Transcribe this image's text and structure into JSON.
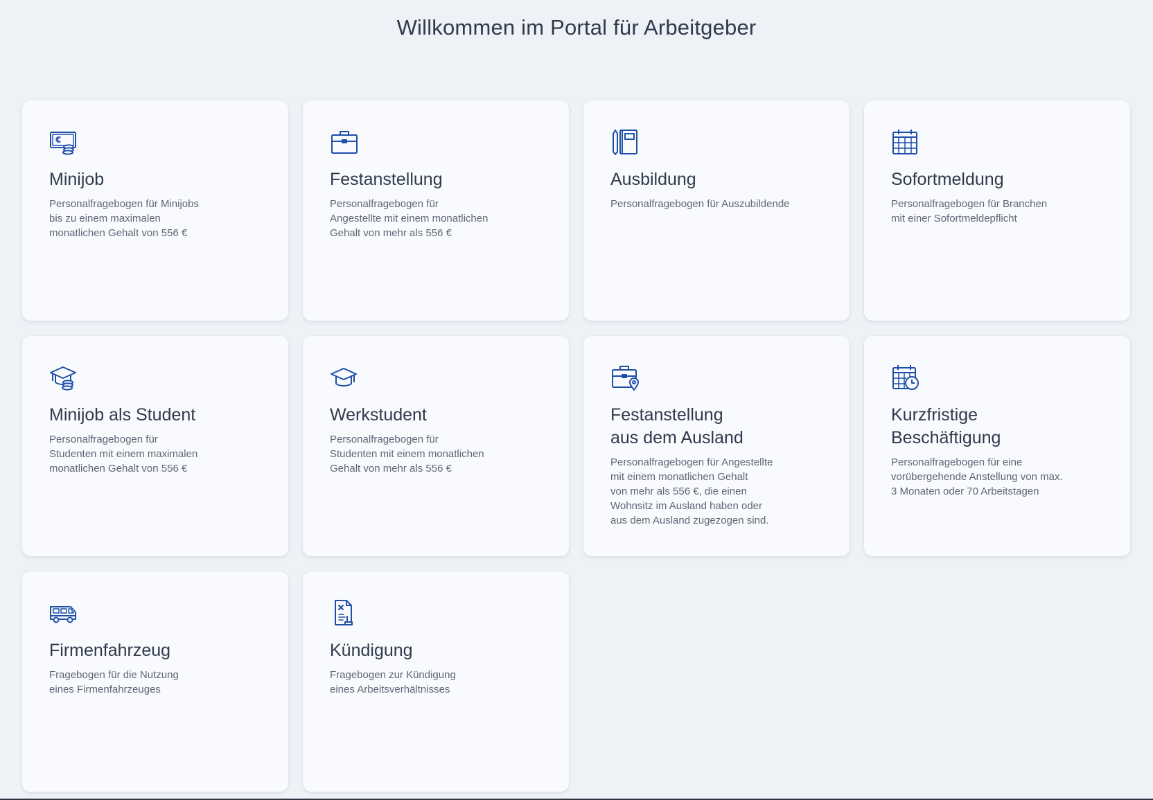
{
  "page": {
    "title": "Willkommen im Portal für Arbeitgeber"
  },
  "colors": {
    "background": "#eef2f7",
    "card": "#f8fafd",
    "icon": "#1f4fa8",
    "title_text": "#2f3a4c",
    "desc_text": "#5d6776"
  },
  "cards": [
    {
      "icon": "euro-payment-icon",
      "title": "Minijob",
      "desc": "Personalfragebogen für Minijobs\nbis zu einem maximalen\nmonatlichen Gehalt von 556 €"
    },
    {
      "icon": "briefcase-icon",
      "title": "Festanstellung",
      "desc": "Personalfragebogen für\nAngestellte mit einem monatlichen\nGehalt von mehr als 556 €"
    },
    {
      "icon": "notebook-pencil-icon",
      "title": "Ausbildung",
      "desc": "Personalfragebogen für Auszubildende"
    },
    {
      "icon": "calendar-icon",
      "title": "Sofortmeldung",
      "desc": "Personalfragebogen für Branchen\nmit einer Sofortmeldepflicht"
    },
    {
      "icon": "graduation-cap-coins-icon",
      "title": "Minijob als Student",
      "desc": "Personalfragebogen für\nStudenten mit einem maximalen\nmonatlichen Gehalt von 556 €"
    },
    {
      "icon": "graduation-cap-icon",
      "title": "Werkstudent",
      "desc": "Personalfragebogen für\nStudenten mit einem monatlichen\nGehalt von mehr als 556 €"
    },
    {
      "icon": "briefcase-location-icon",
      "title": "Festanstellung\naus dem Ausland",
      "desc": "Personalfragebogen für Angestellte\nmit einem monatlichen Gehalt\nvon mehr als 556 €, die einen\nWohnsitz im Ausland haben oder\naus dem Ausland zugezogen sind."
    },
    {
      "icon": "calendar-clock-icon",
      "title": "Kurzfristige\nBeschäftigung",
      "desc": "Personalfragebogen für eine\nvorübergehende Anstellung von max.\n3 Monaten oder 70 Arbeitstagen"
    },
    {
      "icon": "van-icon",
      "title": "Firmenfahrzeug",
      "desc": "Fragebogen für die Nutzung\neines Firmenfahrzeuges"
    },
    {
      "icon": "document-termination-icon",
      "title": "Kündigung",
      "desc": "Fragebogen zur Kündigung\neines Arbeitsverhältnisses"
    }
  ]
}
